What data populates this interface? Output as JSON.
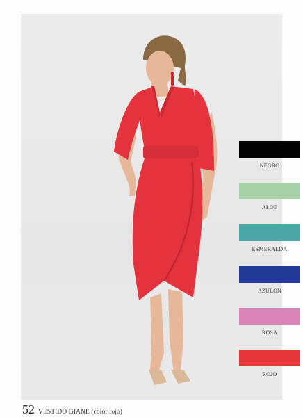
{
  "page": {
    "number": "52",
    "caption": "VESTIDO GIANE (color rojo)"
  },
  "colors": {
    "dress": "#e4333d",
    "background": "#ececec"
  },
  "swatches": [
    {
      "label": "NEGRO",
      "color": "#000000"
    },
    {
      "label": "ALOE",
      "color": "#a5d0a8"
    },
    {
      "label": "ESMERALDA",
      "color": "#4fa8a8"
    },
    {
      "label": "AZULON",
      "color": "#233a94"
    },
    {
      "label": "ROSA",
      "color": "#da84b8"
    },
    {
      "label": "ROJO",
      "color": "#e6383c"
    }
  ]
}
